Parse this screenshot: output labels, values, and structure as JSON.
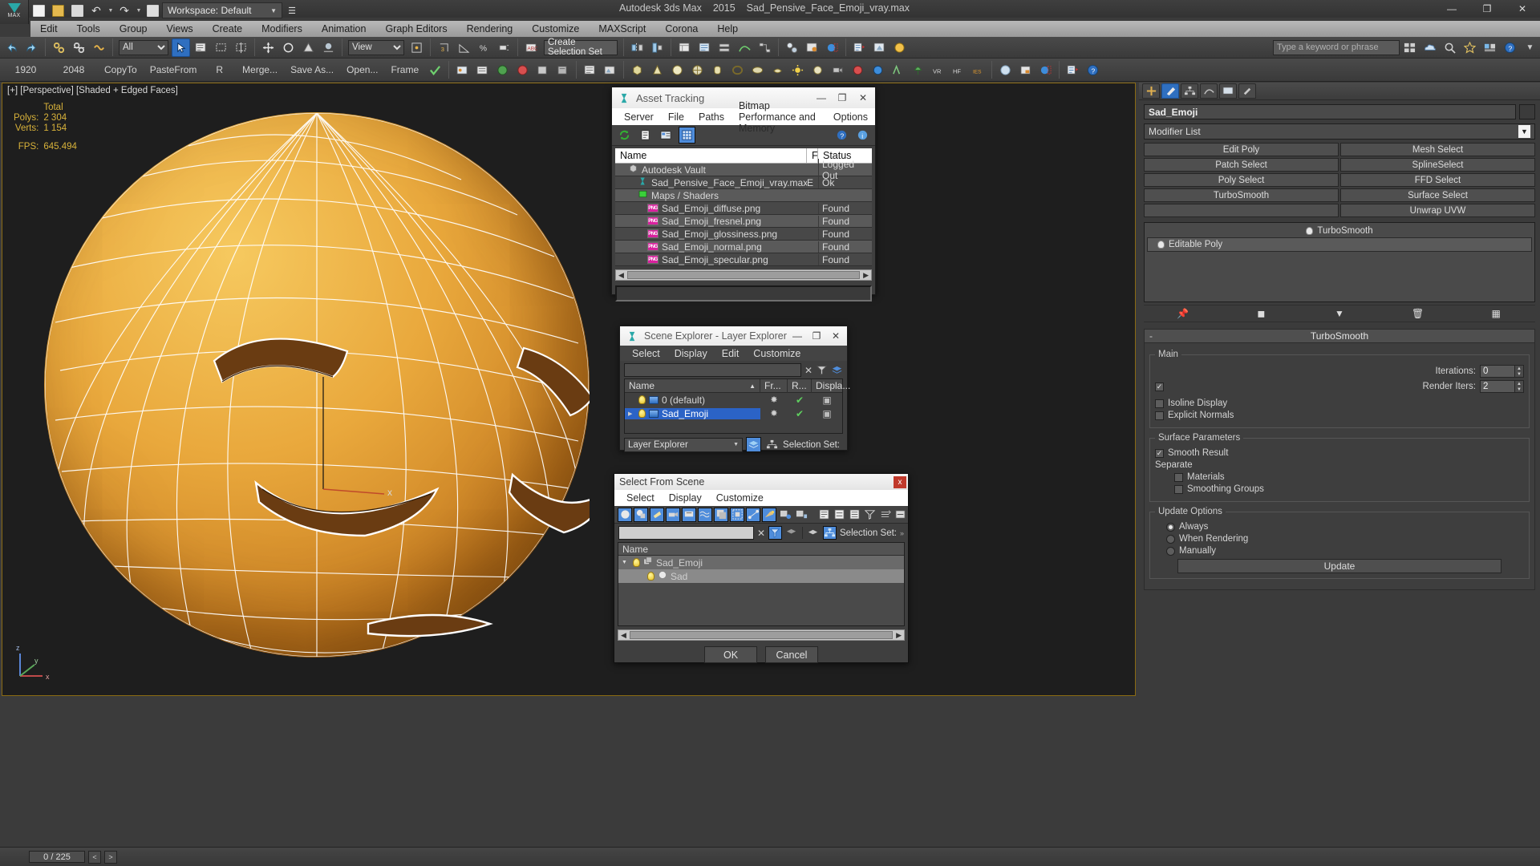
{
  "titlebar": {
    "app": "Autodesk 3ds Max",
    "version": "2015",
    "file": "Sad_Pensive_Face_Emoji_vray.max",
    "minimize": "—",
    "maximize": "❐",
    "close": "✕"
  },
  "quick_access": {
    "logo_label": "MAX",
    "workspace_label": "Workspace: Default",
    "items": [
      "new-scene",
      "open-file",
      "save-file",
      "undo",
      "redo",
      "project-folder"
    ]
  },
  "menubar": {
    "items": [
      "Edit",
      "Tools",
      "Group",
      "Views",
      "Create",
      "Modifiers",
      "Animation",
      "Graph Editors",
      "Rendering",
      "Customize",
      "MAXScript",
      "Corona",
      "Help"
    ]
  },
  "search": {
    "placeholder": "Type a keyword or phrase"
  },
  "toolbar1": {
    "select_filter": "All",
    "view_coord": "View",
    "named_selection": "Create Selection Set"
  },
  "toolbar2": {
    "width": "1920",
    "height": "2048",
    "copy_to": "CopyTo",
    "paste_from": "PasteFrom",
    "r_label": "R",
    "merge": "Merge...",
    "save_as": "Save As...",
    "open": "Open...",
    "frame": "Frame"
  },
  "viewport": {
    "label": "[+] [Perspective] [Shaded + Edged Faces]",
    "stats": {
      "header": "Total",
      "rows": [
        {
          "key": "Polys:",
          "value": "2 304"
        },
        {
          "key": "Verts:",
          "value": "1 154"
        }
      ],
      "fps_key": "FPS:",
      "fps_value": "645.494"
    },
    "axis": {
      "z": "z",
      "y": "y",
      "x": "x"
    },
    "gizmo_x": "x"
  },
  "asset_tracking": {
    "title": "Asset Tracking",
    "menu": [
      "Server",
      "File",
      "Paths",
      "Bitmap Performance and Memory",
      "Options"
    ],
    "columns": [
      "Name",
      "F",
      "Status"
    ],
    "rows": [
      {
        "name": "Autodesk Vault",
        "icon": "vault-icon",
        "indent": 1,
        "f": "",
        "status": "Logged Out"
      },
      {
        "name": "Sad_Pensive_Face_Emoji_vray.max",
        "icon": "max-file-icon",
        "indent": 2,
        "f": "E",
        "status": "Ok"
      },
      {
        "name": "Maps / Shaders",
        "icon": "maps-icon",
        "indent": 2,
        "f": "",
        "status": ""
      },
      {
        "name": "Sad_Emoji_diffuse.png",
        "icon": "png-icon",
        "indent": 3,
        "f": "",
        "status": "Found"
      },
      {
        "name": "Sad_Emoji_fresnel.png",
        "icon": "png-icon",
        "indent": 3,
        "f": "",
        "status": "Found"
      },
      {
        "name": "Sad_Emoji_glossiness.png",
        "icon": "png-icon",
        "indent": 3,
        "f": "",
        "status": "Found"
      },
      {
        "name": "Sad_Emoji_normal.png",
        "icon": "png-icon",
        "indent": 3,
        "f": "",
        "status": "Found"
      },
      {
        "name": "Sad_Emoji_specular.png",
        "icon": "png-icon",
        "indent": 3,
        "f": "",
        "status": "Found"
      }
    ],
    "path_field": ""
  },
  "scene_explorer": {
    "title": "Scene Explorer - Layer Explorer",
    "menu": [
      "Select",
      "Display",
      "Edit",
      "Customize"
    ],
    "filter_value": "",
    "columns": [
      "Name",
      "Fr...",
      "R...",
      "Displa..."
    ],
    "rows": [
      {
        "name": "0 (default)",
        "selected": false,
        "expandable": false,
        "frozen": "✸",
        "render": "✔",
        "display": "▣"
      },
      {
        "name": "Sad_Emoji",
        "selected": true,
        "expandable": true,
        "frozen": "✸",
        "render": "✔",
        "display": "▣"
      }
    ],
    "mode_dropdown": "Layer Explorer",
    "selection_set_label": "Selection Set:"
  },
  "select_from_scene": {
    "title": "Select From Scene",
    "close": "x",
    "menu": [
      "Select",
      "Display",
      "Customize"
    ],
    "filter_value": "",
    "selection_set_label": "Selection Set:",
    "column": "Name",
    "rows": [
      {
        "name": "Sad_Emoji",
        "indent": 1,
        "icon": "group-icon",
        "expanded": true
      },
      {
        "name": "Sad",
        "indent": 2,
        "icon": "sphere-icon",
        "expanded": false
      }
    ],
    "ok": "OK",
    "cancel": "Cancel"
  },
  "command_panel": {
    "tabs": [
      "create",
      "modify",
      "hierarchy",
      "motion",
      "display",
      "utilities"
    ],
    "selected_tab_index": 1,
    "object_name": "Sad_Emoji",
    "object_color": "#c98c2e",
    "modifier_list_label": "Modifier List",
    "modifier_buttons": [
      "Edit Poly",
      "Mesh Select",
      "Patch Select",
      "SplineSelect",
      "Poly Select",
      "FFD Select",
      "TurboSmooth",
      "Surface Select",
      "",
      "Unwrap UVW"
    ],
    "stack": [
      {
        "name": "TurboSmooth",
        "active": true
      },
      {
        "name": "Editable Poly",
        "active": false
      }
    ],
    "rollout": {
      "title": "TurboSmooth",
      "collapse": "-",
      "main": {
        "legend": "Main",
        "iterations_label": "Iterations:",
        "iterations_value": "0",
        "render_iters_label": "Render Iters:",
        "render_iters_value": "2",
        "render_iters_checked": true,
        "isoline_label": "Isoline Display",
        "isoline_checked": false,
        "explicit_label": "Explicit Normals",
        "explicit_checked": false
      },
      "surface": {
        "legend": "Surface Parameters",
        "smooth_result_label": "Smooth Result",
        "smooth_result_checked": true,
        "separate_label": "Separate",
        "materials_label": "Materials",
        "materials_checked": false,
        "smoothing_groups_label": "Smoothing Groups",
        "smoothing_groups_checked": false
      },
      "update": {
        "legend": "Update Options",
        "options": [
          "Always",
          "When Rendering",
          "Manually"
        ],
        "selected": 0,
        "button": "Update"
      }
    }
  },
  "statusbar": {
    "frame": "0 / 225",
    "prev": "<",
    "next": ">"
  }
}
